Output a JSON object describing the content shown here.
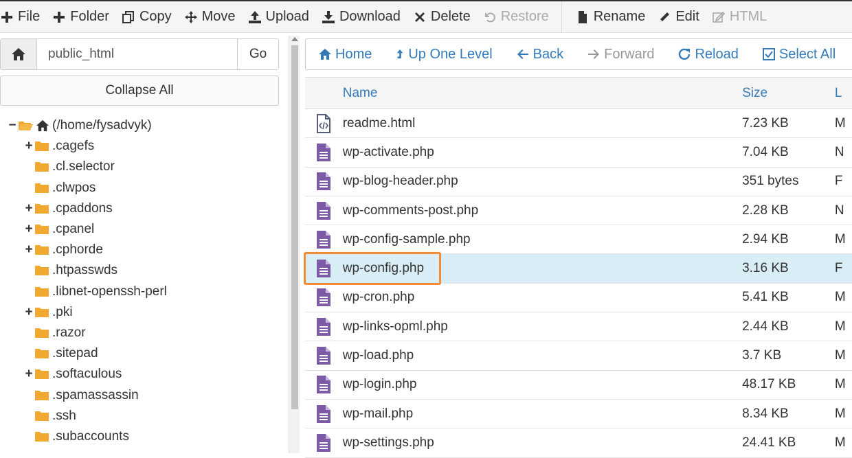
{
  "toolbar": {
    "items": [
      {
        "label": "File",
        "icon": "plus-icon",
        "disabled": false
      },
      {
        "label": "Folder",
        "icon": "plus-icon",
        "disabled": false
      },
      {
        "label": "Copy",
        "icon": "copy-icon",
        "disabled": false
      },
      {
        "label": "Move",
        "icon": "move-icon",
        "disabled": false
      },
      {
        "label": "Upload",
        "icon": "upload-icon",
        "disabled": false
      },
      {
        "label": "Download",
        "icon": "download-icon",
        "disabled": false
      },
      {
        "label": "Delete",
        "icon": "delete-icon",
        "disabled": false
      },
      {
        "label": "Restore",
        "icon": "restore-icon",
        "disabled": true
      },
      {
        "label": "Rename",
        "icon": "rename-icon",
        "disabled": false
      },
      {
        "label": "Edit",
        "icon": "edit-icon",
        "disabled": false
      },
      {
        "label": "HTML",
        "icon": "html-editor-icon",
        "disabled": true
      }
    ]
  },
  "left_panel": {
    "path_value": "public_html",
    "go_label": "Go",
    "collapse_label": "Collapse All",
    "tree_root": "(/home/fysadvyk)",
    "tree": [
      {
        "label": ".cagefs",
        "expandable": true
      },
      {
        "label": ".cl.selector",
        "expandable": false
      },
      {
        "label": ".clwpos",
        "expandable": false
      },
      {
        "label": ".cpaddons",
        "expandable": true
      },
      {
        "label": ".cpanel",
        "expandable": true
      },
      {
        "label": ".cphorde",
        "expandable": true
      },
      {
        "label": ".htpasswds",
        "expandable": false
      },
      {
        "label": ".libnet-openssh-perl",
        "expandable": false
      },
      {
        "label": ".pki",
        "expandable": true
      },
      {
        "label": ".razor",
        "expandable": false
      },
      {
        "label": ".sitepad",
        "expandable": false
      },
      {
        "label": ".softaculous",
        "expandable": true
      },
      {
        "label": ".spamassassin",
        "expandable": false
      },
      {
        "label": ".ssh",
        "expandable": false
      },
      {
        "label": ".subaccounts",
        "expandable": false
      }
    ]
  },
  "nav": {
    "items": [
      {
        "label": "Home",
        "icon": "home-icon",
        "disabled": false
      },
      {
        "label": "Up One Level",
        "icon": "up-level-icon",
        "disabled": false
      },
      {
        "label": "Back",
        "icon": "back-arrow-icon",
        "disabled": false
      },
      {
        "label": "Forward",
        "icon": "forward-arrow-icon",
        "disabled": true
      },
      {
        "label": "Reload",
        "icon": "reload-icon",
        "disabled": false
      },
      {
        "label": "Select All",
        "icon": "select-all-icon",
        "disabled": false
      }
    ]
  },
  "files": {
    "columns": {
      "name": "Name",
      "size": "Size",
      "last": "L"
    },
    "rows": [
      {
        "name": "readme.html",
        "size": "7.23 KB",
        "last": "M",
        "type": "html"
      },
      {
        "name": "wp-activate.php",
        "size": "7.04 KB",
        "last": "N",
        "type": "doc"
      },
      {
        "name": "wp-blog-header.php",
        "size": "351 bytes",
        "last": "F",
        "type": "doc"
      },
      {
        "name": "wp-comments-post.php",
        "size": "2.28 KB",
        "last": "N",
        "type": "doc"
      },
      {
        "name": "wp-config-sample.php",
        "size": "2.94 KB",
        "last": "M",
        "type": "doc"
      },
      {
        "name": "wp-config.php",
        "size": "3.16 KB",
        "last": "F",
        "type": "doc",
        "selected": true
      },
      {
        "name": "wp-cron.php",
        "size": "5.41 KB",
        "last": "M",
        "type": "doc"
      },
      {
        "name": "wp-links-opml.php",
        "size": "2.44 KB",
        "last": "M",
        "type": "doc"
      },
      {
        "name": "wp-load.php",
        "size": "3.7 KB",
        "last": "M",
        "type": "doc"
      },
      {
        "name": "wp-login.php",
        "size": "48.17 KB",
        "last": "M",
        "type": "doc"
      },
      {
        "name": "wp-mail.php",
        "size": "8.34 KB",
        "last": "M",
        "type": "doc"
      },
      {
        "name": "wp-settings.php",
        "size": "24.41 KB",
        "last": "M",
        "type": "doc"
      }
    ]
  },
  "colors": {
    "link": "#337ab7",
    "file_icon": "#7d5aa6",
    "folder": "#f0a830",
    "selected_row": "#d9edf7",
    "highlight": "#f28b33"
  }
}
